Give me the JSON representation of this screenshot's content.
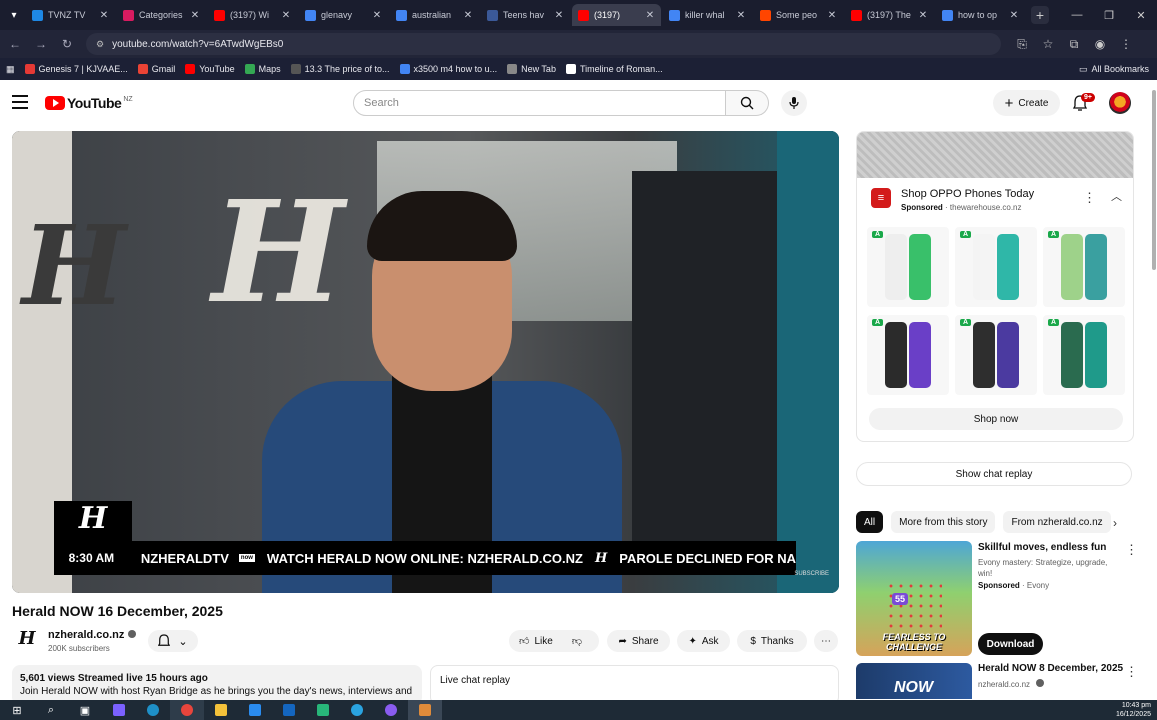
{
  "browser": {
    "tabs": [
      {
        "title": "TVNZ TV",
        "color": "#1e88e5",
        "active": false
      },
      {
        "title": "Categories",
        "color": "#d81b60",
        "active": false
      },
      {
        "title": "(3197) Wi",
        "color": "#ff0000",
        "active": false
      },
      {
        "title": "glenavy",
        "color": "#4285f4",
        "active": false
      },
      {
        "title": "australian",
        "color": "#4285f4",
        "active": false
      },
      {
        "title": "Teens hav",
        "color": "#3b5998",
        "active": false
      },
      {
        "title": "(3197)",
        "color": "#ff0000",
        "active": true
      },
      {
        "title": "killer whal",
        "color": "#4285f4",
        "active": false
      },
      {
        "title": "Some peo",
        "color": "#ff4500",
        "active": false
      },
      {
        "title": "(3197) The",
        "color": "#ff0000",
        "active": false
      },
      {
        "title": "how to op",
        "color": "#4285f4",
        "active": false
      }
    ],
    "url": "youtube.com/watch?v=6ATwdWgEBs0",
    "bookmarks": [
      {
        "label": "Genesis 7 | KJVAAE...",
        "color": "#e53935"
      },
      {
        "label": "Gmail",
        "color": "#ea4335"
      },
      {
        "label": "YouTube",
        "color": "#ff0000"
      },
      {
        "label": "Maps",
        "color": "#34a853"
      },
      {
        "label": "13.3 The price of to...",
        "color": "#555555"
      },
      {
        "label": "x3500 m4 how to u...",
        "color": "#4285f4"
      },
      {
        "label": "New Tab",
        "color": "#888888"
      },
      {
        "label": "Timeline of Roman...",
        "color": "#ffffff"
      }
    ],
    "all_bookmarks": "All Bookmarks"
  },
  "youtube": {
    "logo_text": "YouTube",
    "region": "NZ",
    "search_placeholder": "Search",
    "create_label": "Create",
    "notification_badge": "9+"
  },
  "video": {
    "ticker_time": "8:30 AM",
    "ticker_segments": [
      "NZHERALDTV",
      "WATCH HERALD NOW ONLINE: NZHERALD.CO.NZ",
      "PAROLE DECLINED FOR NA"
    ],
    "ticker_sep": "now",
    "subscribe_mark": "SUBSCRIBE",
    "title": "Herald NOW 16 December, 2025",
    "channel": "nzherald.co.nz",
    "subscribers": "200K subscribers",
    "actions": {
      "like": "Like",
      "share": "Share",
      "ask": "Ask",
      "thanks": "Thanks"
    },
    "description_meta": "5,601 views  Streamed live 15 hours ago",
    "description_text": "Join Herald NOW with host Ryan Bridge as he brings you the day's news, interviews and",
    "live_chat_replay": "Live chat replay"
  },
  "sidebar": {
    "ad": {
      "title": "Shop OPPO Phones Today",
      "sponsored": "Sponsored",
      "advertiser": "thewarehouse.co.nz",
      "phones": [
        {
          "rating": "A",
          "colors": [
            "#eeeeee",
            "#39c06a"
          ]
        },
        {
          "rating": "A",
          "colors": [
            "#f4f4f4",
            "#2fb7a8"
          ]
        },
        {
          "rating": "A",
          "colors": [
            "#9ed28a",
            "#3aa0a0"
          ]
        },
        {
          "rating": "A",
          "colors": [
            "#2b2b2b",
            "#6a3fc7"
          ]
        },
        {
          "rating": "A",
          "colors": [
            "#2e2e2e",
            "#4b3aa0"
          ]
        },
        {
          "rating": "A",
          "colors": [
            "#2a6b4f",
            "#1f9a8a"
          ]
        }
      ],
      "shop_now": "Shop now"
    },
    "show_chat_replay": "Show chat replay",
    "chips": [
      "All",
      "More from this story",
      "From nzherald.co.nz"
    ],
    "game_ad": {
      "title": "Skillful moves, endless fun",
      "desc": "Evony mastery: Strategize, upgrade, win!",
      "sponsored": "Sponsored",
      "advertiser": "Evony",
      "thumb_label": "FEARLESS TO CHALLENGE",
      "thumb_number": "55",
      "download": "Download"
    },
    "rec": {
      "title": "Herald NOW 8 December, 2025",
      "channel": "nzherald.co.nz",
      "thumb_text": "NOW"
    }
  },
  "taskbar": {
    "time": "10:43 pm",
    "date": "16/12/2025"
  }
}
